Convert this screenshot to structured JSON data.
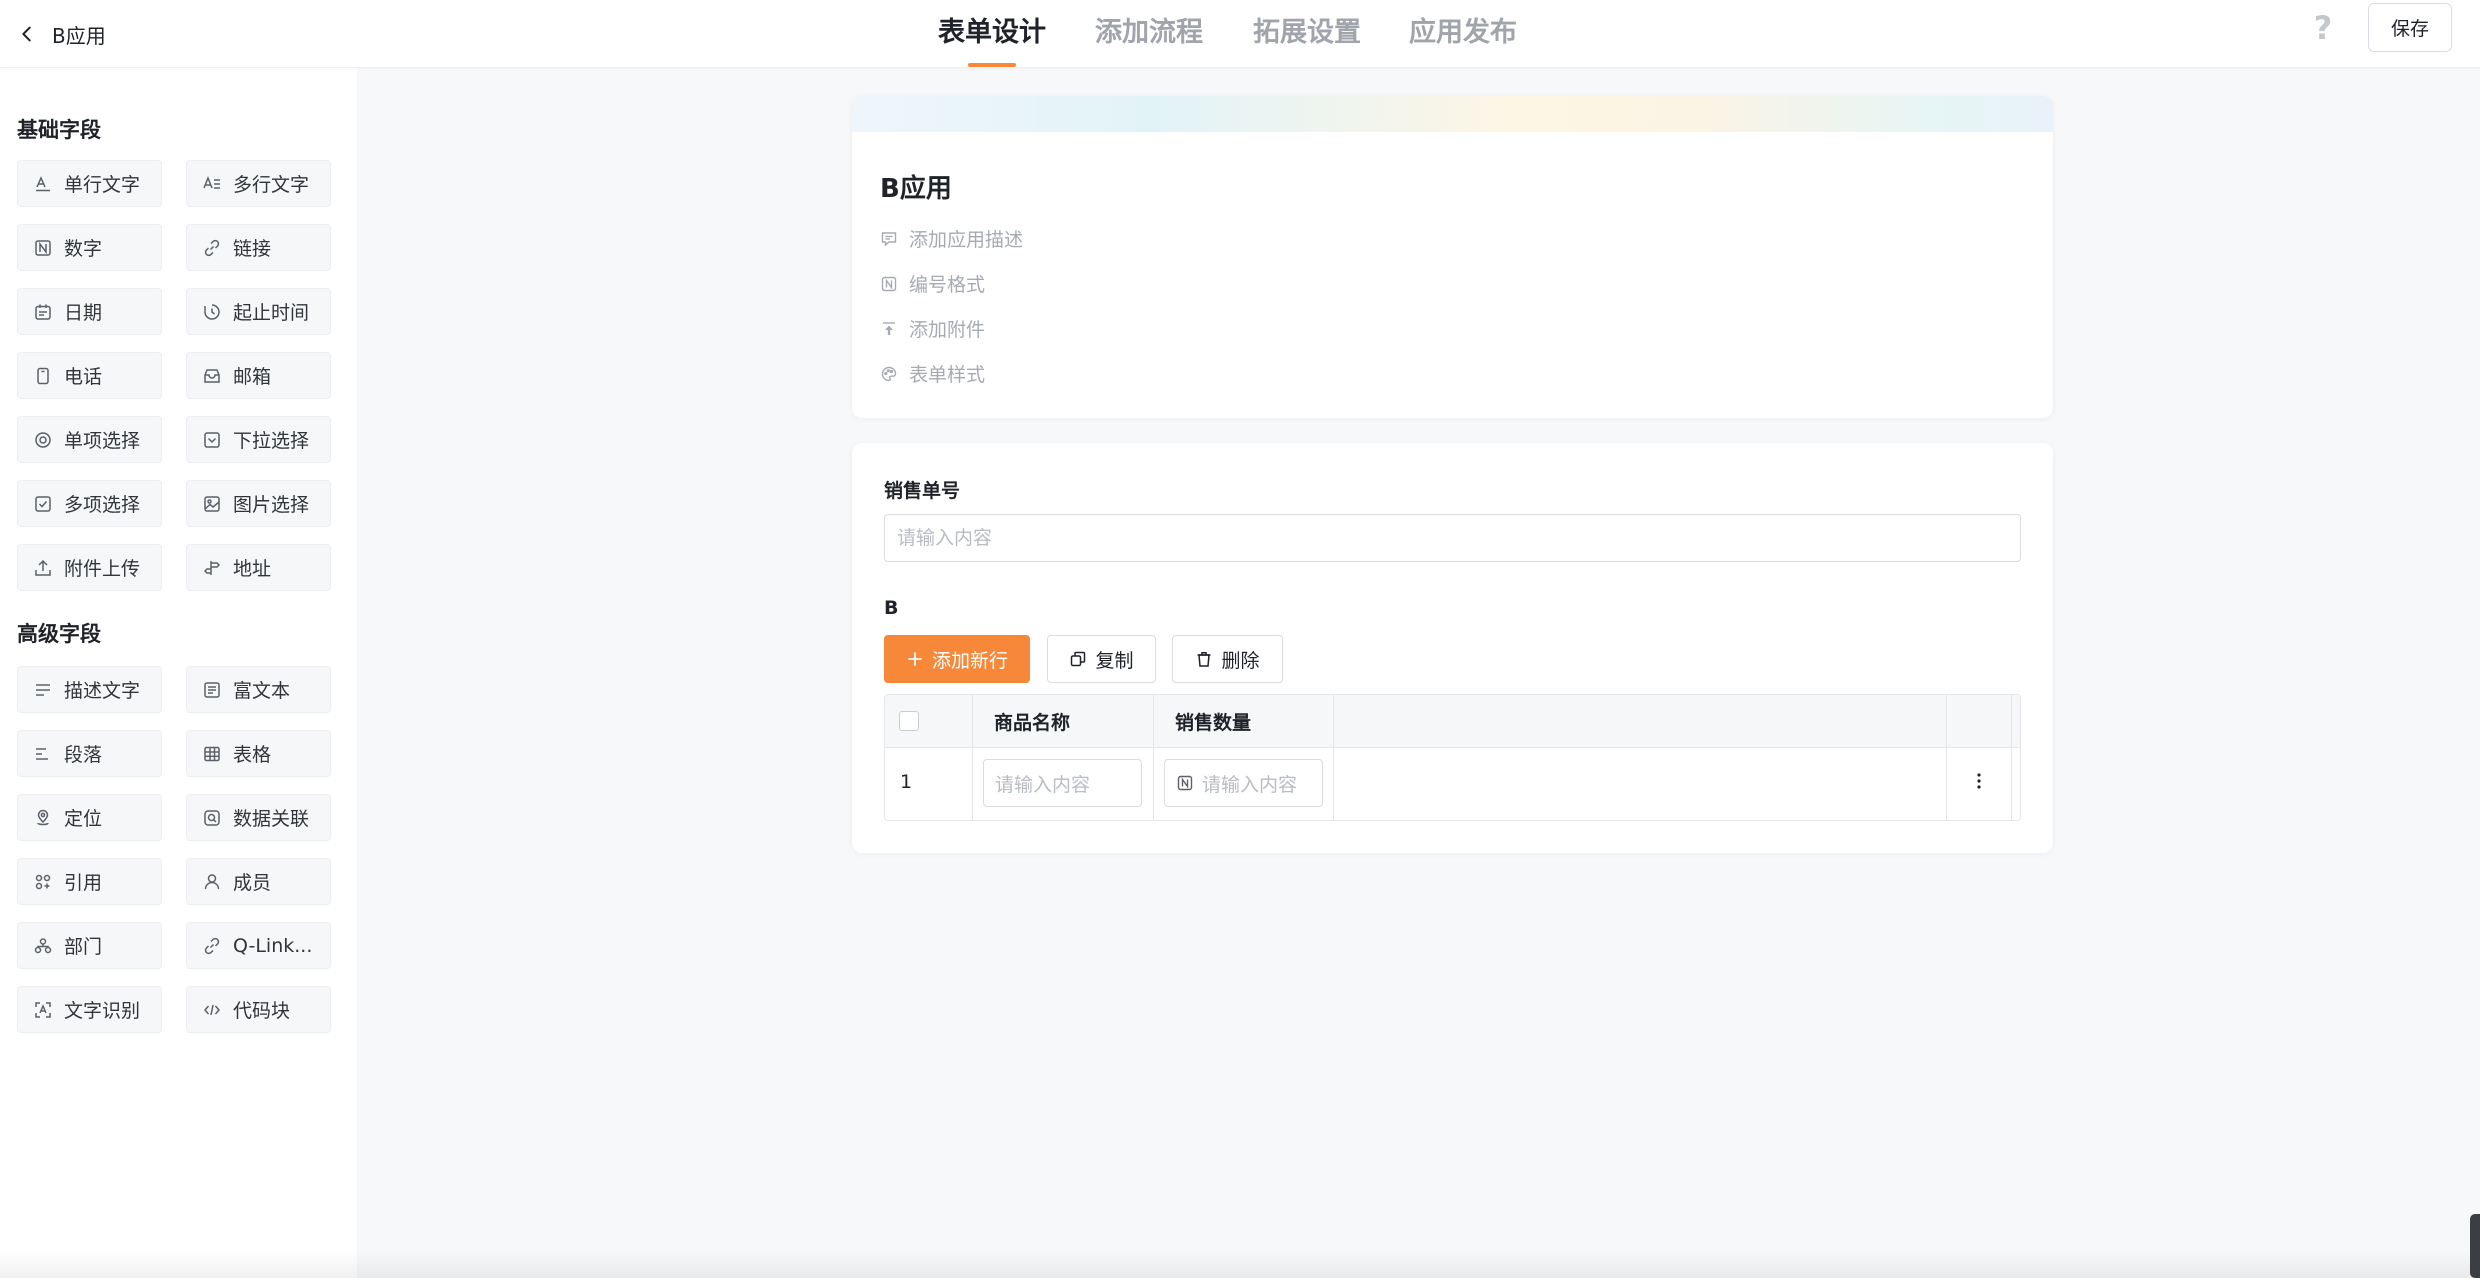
{
  "header": {
    "back_label": "B应用",
    "tabs": [
      {
        "label": "表单设计",
        "active": true
      },
      {
        "label": "添加流程",
        "active": false
      },
      {
        "label": "拓展设置",
        "active": false
      },
      {
        "label": "应用发布",
        "active": false
      }
    ],
    "help_icon": "?",
    "save_label": "保存"
  },
  "sidebar": {
    "basic_title": "基础字段",
    "basic_fields": [
      {
        "label": "单行文字",
        "icon": "single-line-text-icon"
      },
      {
        "label": "多行文字",
        "icon": "multi-line-text-icon"
      },
      {
        "label": "数字",
        "icon": "number-icon"
      },
      {
        "label": "链接",
        "icon": "link-icon"
      },
      {
        "label": "日期",
        "icon": "calendar-icon"
      },
      {
        "label": "起止时间",
        "icon": "time-range-icon"
      },
      {
        "label": "电话",
        "icon": "phone-icon"
      },
      {
        "label": "邮箱",
        "icon": "mailbox-icon"
      },
      {
        "label": "单项选择",
        "icon": "radio-icon"
      },
      {
        "label": "下拉选择",
        "icon": "dropdown-icon"
      },
      {
        "label": "多项选择",
        "icon": "checkbox-icon"
      },
      {
        "label": "图片选择",
        "icon": "image-icon"
      },
      {
        "label": "附件上传",
        "icon": "upload-icon"
      },
      {
        "label": "地址",
        "icon": "signpost-icon"
      }
    ],
    "advanced_title": "高级字段",
    "advanced_fields": [
      {
        "label": "描述文字",
        "icon": "description-icon"
      },
      {
        "label": "富文本",
        "icon": "rich-text-icon"
      },
      {
        "label": "段落",
        "icon": "paragraph-icon"
      },
      {
        "label": "表格",
        "icon": "table-icon"
      },
      {
        "label": "定位",
        "icon": "location-icon"
      },
      {
        "label": "数据关联",
        "icon": "data-link-icon"
      },
      {
        "label": "引用",
        "icon": "reference-icon"
      },
      {
        "label": "成员",
        "icon": "member-icon"
      },
      {
        "label": "部门",
        "icon": "department-icon"
      },
      {
        "label": "Q-Link...",
        "icon": "qlink-icon"
      },
      {
        "label": "文字识别",
        "icon": "ocr-icon"
      },
      {
        "label": "代码块",
        "icon": "code-icon"
      }
    ]
  },
  "form_header": {
    "title": "B应用",
    "meta": [
      {
        "label": "添加应用描述",
        "icon": "comment-icon"
      },
      {
        "label": "编号格式",
        "icon": "number-format-icon"
      },
      {
        "label": "添加附件",
        "icon": "upload-icon"
      },
      {
        "label": "表单样式",
        "icon": "palette-icon"
      }
    ]
  },
  "form_body": {
    "sales_no_label": "销售单号",
    "sales_no_placeholder": "请输入内容",
    "subtable_label": "B",
    "add_row_label": "添加新行",
    "copy_label": "复制",
    "delete_label": "删除",
    "columns": [
      "商品名称",
      "销售数量"
    ],
    "rows": [
      {
        "index": "1",
        "name_placeholder": "请输入内容",
        "qty_placeholder": "请输入内容"
      }
    ]
  },
  "colors": {
    "accent": "#f7883a",
    "text": "#1f2329",
    "muted": "#a6abb3",
    "border": "#d9dce1"
  }
}
